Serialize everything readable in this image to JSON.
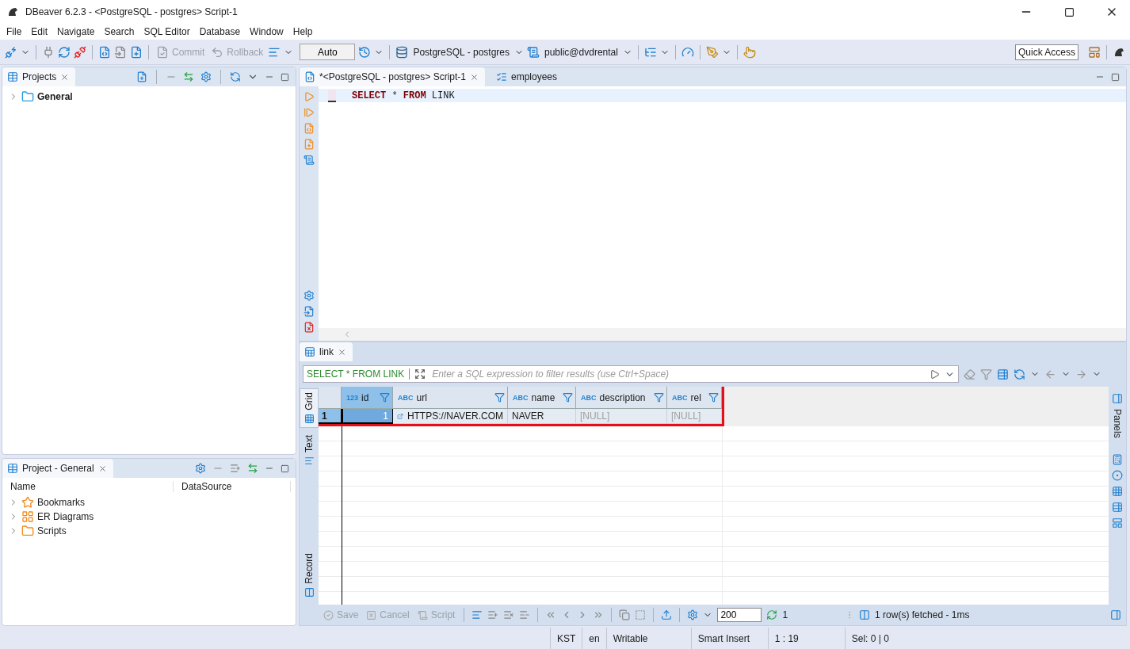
{
  "window": {
    "title": "DBeaver 6.2.3 - <PostgreSQL - postgres> Script-1"
  },
  "menu": [
    "File",
    "Edit",
    "Navigate",
    "Search",
    "SQL Editor",
    "Database",
    "Window",
    "Help"
  ],
  "toolbar": {
    "commit": {
      "label": "Commit",
      "disabled": true
    },
    "rollback": {
      "label": "Rollback",
      "disabled": true
    },
    "mode": "Auto",
    "connection": "PostgreSQL - postgres",
    "schema": "public@dvdrental",
    "quick_access": "Quick Access"
  },
  "projects_panel": {
    "title": "Projects",
    "items": [
      {
        "label": "General",
        "expanded": false
      }
    ]
  },
  "project_panel": {
    "title": "Project - General",
    "columns": [
      "Name",
      "DataSource"
    ],
    "items": [
      {
        "label": "Bookmarks",
        "kind": "bookmarks",
        "expanded": false
      },
      {
        "label": "ER Diagrams",
        "kind": "diagrams",
        "expanded": false
      },
      {
        "label": "Scripts",
        "kind": "scripts",
        "expanded": false
      }
    ]
  },
  "editor_tabs": [
    {
      "label": "*<PostgreSQL - postgres> Script-1",
      "kind": "script",
      "selected": true
    },
    {
      "label": "employees",
      "kind": "table",
      "selected": false
    }
  ],
  "editor": {
    "tokens": [
      {
        "text": "SELECT",
        "kind": "keyword"
      },
      {
        "text": "*",
        "kind": "plain"
      },
      {
        "text": "FROM",
        "kind": "keyword"
      },
      {
        "text": "LINK",
        "kind": "plain"
      }
    ]
  },
  "results": {
    "tab": "link",
    "query": "SELECT * FROM LINK",
    "filter_placeholder": "Enter a SQL expression to filter results (use Ctrl+Space)",
    "side_tabs": [
      {
        "label": "Grid",
        "selected": true
      },
      {
        "label": "Text",
        "selected": false
      },
      {
        "label": "Record",
        "selected": false
      }
    ],
    "highlighted": true,
    "columns": [
      {
        "type": "123",
        "name": "id"
      },
      {
        "type": "ABC",
        "name": "url"
      },
      {
        "type": "ABC",
        "name": "name"
      },
      {
        "type": "ABC",
        "name": "description"
      },
      {
        "type": "ABC",
        "name": "rel"
      }
    ],
    "rows": [
      {
        "number": "1",
        "selected": true,
        "cells": [
          {
            "text": "1",
            "kind": "number",
            "selected": true
          },
          {
            "text": "HTTPS://NAVER.COM",
            "kind": "link",
            "selected": false
          },
          {
            "text": "NAVER",
            "kind": "text",
            "selected": false
          },
          {
            "text": "[NULL]",
            "kind": "null",
            "selected": false
          },
          {
            "text": "[NULL]",
            "kind": "null",
            "selected": false
          }
        ]
      }
    ],
    "panels_label": "Panels"
  },
  "results_footer": {
    "save": "Save",
    "cancel": "Cancel",
    "script": "Script",
    "fetch_size": "200",
    "count": "1",
    "status": "1 row(s) fetched - 1ms"
  },
  "status_bar": [
    "KST",
    "en",
    "Writable",
    "Smart Insert",
    "1 : 19",
    "Sel: 0 | 0"
  ]
}
